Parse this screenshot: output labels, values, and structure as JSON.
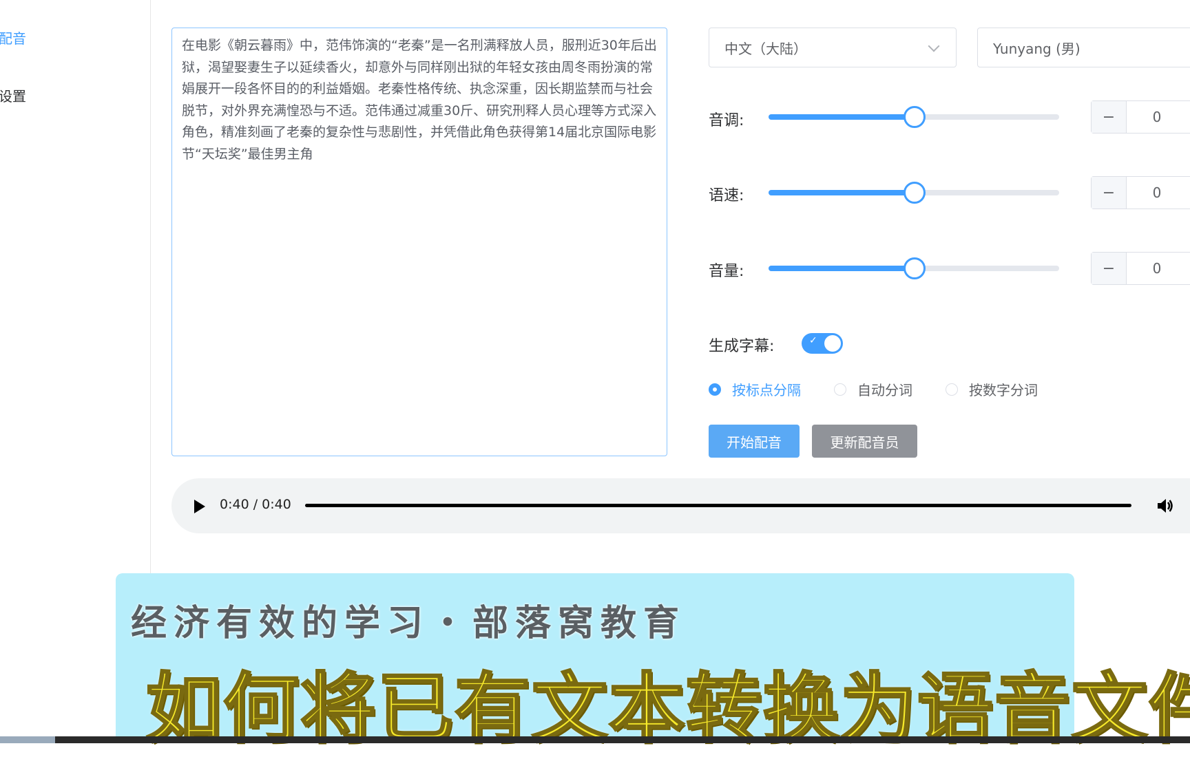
{
  "sidebar": {
    "items": [
      {
        "label": "配音",
        "active": true
      },
      {
        "label": "设置",
        "active": false
      }
    ]
  },
  "editor": {
    "text": "在电影《朝云暮雨》中，范伟饰演的“老秦”是一名刑满释放人员，服刑近30年后出狱，渴望娶妻生子以延续香火，却意外与同样刚出狱的年轻女孩由周冬雨扮演的常娟展开一段各怀目的的利益婚姻。老秦性格传统、执念深重，因长期监禁而与社会脱节，对外界充满惶恐与不适。范伟通过减重30斤、研究刑释人员心理等方式深入角色，精准刻画了老秦的复杂性与悲剧性，并凭借此角色获得第14届北京国际电影节“天坛奖”最佳男主角"
  },
  "language_select": {
    "value": "中文（大陆）"
  },
  "voice_select": {
    "value": "Yunyang (男)"
  },
  "controls": {
    "pitch": {
      "label": "音调:",
      "value": "0",
      "level": 0.5
    },
    "speed": {
      "label": "语速:",
      "value": "0",
      "level": 0.5
    },
    "volume": {
      "label": "音量:",
      "value": "0",
      "level": 0.5
    }
  },
  "subtitles": {
    "label": "生成字幕:",
    "enabled": true,
    "options": [
      {
        "label": "按标点分隔",
        "checked": true
      },
      {
        "label": "自动分词",
        "checked": false
      },
      {
        "label": "按数字分词",
        "checked": false
      }
    ]
  },
  "actions": {
    "start_label": "开始配音",
    "update_label": "更新配音员"
  },
  "player": {
    "time": "0:40 / 0:40",
    "progress": 1.0
  },
  "banner": {
    "subtitle": "经济有效的学习・部落窝教育",
    "title": "如何将已有文本转换为语音文件"
  },
  "colors": {
    "accent": "#409eff",
    "banner_bg": "#b7eefb",
    "banner_title": "#f7ea2a"
  }
}
